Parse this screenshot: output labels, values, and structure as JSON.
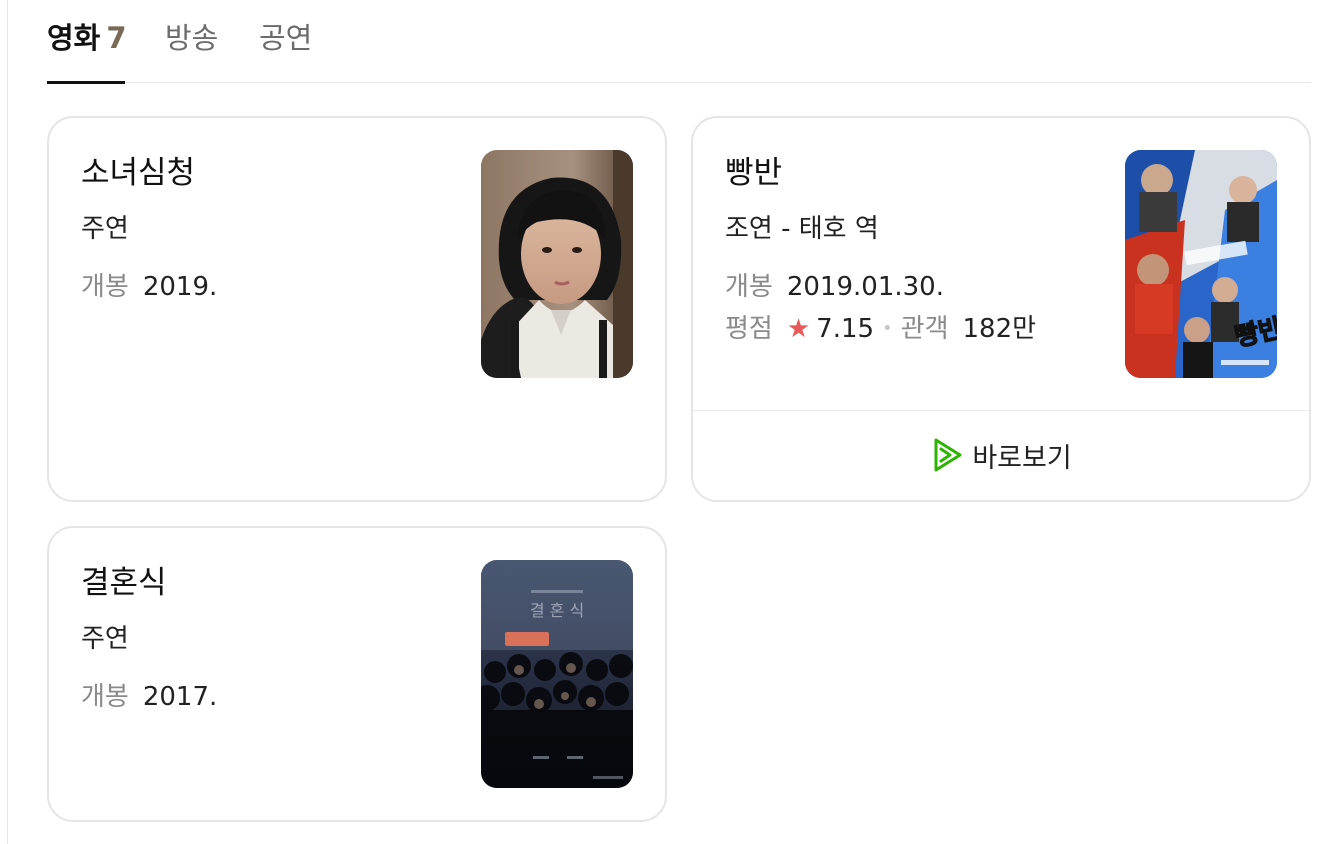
{
  "tabs": {
    "movie": {
      "label": "영화",
      "count": "7"
    },
    "broadcast": {
      "label": "방송"
    },
    "performance": {
      "label": "공연"
    }
  },
  "cards": [
    {
      "title": "소녀심청",
      "role": "주연",
      "release_label": "개봉",
      "release_value": "2019."
    },
    {
      "title": "빵반",
      "role": "조연 - 태호 역",
      "release_label": "개봉",
      "release_value": "2019.01.30.",
      "rating_label": "평점",
      "rating_icon": "star-icon",
      "rating_value": "7.15",
      "audience_label": "관객",
      "audience_value": "182만",
      "watch_label": "바로보기",
      "watch_icon": "play-icon",
      "star_color": "#e85a5a",
      "play_color": "#2db400"
    },
    {
      "title": "결혼식",
      "role": "주연",
      "release_label": "개봉",
      "release_value": "2017."
    }
  ]
}
